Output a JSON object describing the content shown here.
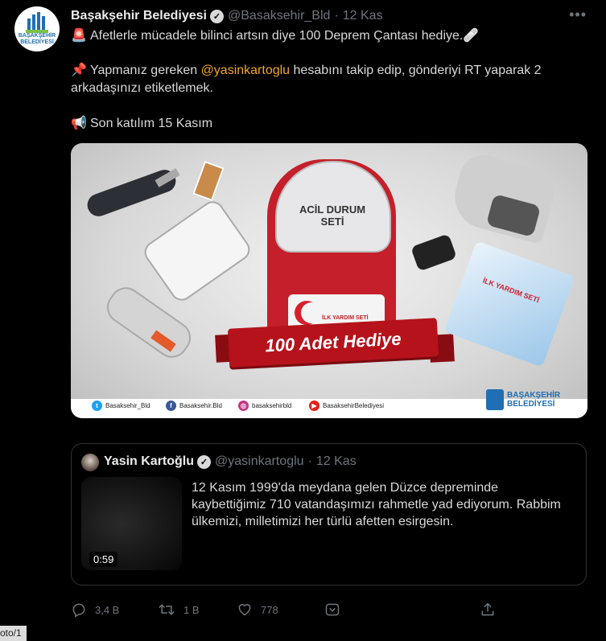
{
  "tweet": {
    "author_name": "Başakşehir Belediyesi",
    "author_handle": "@Basaksehir_Bld",
    "separator": "·",
    "time": "12 Kas",
    "more_icon": "more-horizontal-icon",
    "avatar_text": "BAŞAKŞEHİR BELEDİYESİ",
    "line1": "Afetlerle mücadele bilinci artsın diye 100 Deprem Çantası hediye.",
    "line2_prefix": "Yapmanız gereken ",
    "line2_mention": "@yasinkartoglu",
    "line2_suffix": " hesabını takip edip, gönderiyi RT yaparak 2 arkadaşınızı etiketlemek.",
    "line3": "Son katılım 15 Kasım",
    "emoji1": "🚨",
    "emoji1_end": "🩹",
    "emoji2": "📌",
    "emoji3": "📢"
  },
  "media": {
    "bag_label": "ACİL DURUM SETİ",
    "card_text": "İLK YARDIM SETİ",
    "ribbon_text": "100 Adet Hediye",
    "blanket_text": "İLK YARDIM SETİ",
    "social": [
      {
        "icon": "twitter-icon",
        "label": "Basaksehir_Bld",
        "color": "#1da1f2",
        "glyph": "t"
      },
      {
        "icon": "facebook-icon",
        "label": "Basaksehir.Bld",
        "color": "#3b5998",
        "glyph": "f"
      },
      {
        "icon": "instagram-icon",
        "label": "basaksehirbld",
        "color": "#c13584",
        "glyph": "◎"
      },
      {
        "icon": "youtube-icon",
        "label": "BasaksehirBelediyesi",
        "color": "#e62117",
        "glyph": "▶"
      }
    ],
    "brand_line1": "BAŞAKŞEHİR",
    "brand_line2": "BELEDİYESİ"
  },
  "quote": {
    "author_name": "Yasin Kartoğlu",
    "author_handle": "@yasinkartoglu",
    "separator": "·",
    "time": "12 Kas",
    "text": "12 Kasım 1999'da meydana gelen Düzce depreminde kaybettiğimiz 710 vatandaşımızı rahmetle yad ediyorum. Rabbim ülkemizi, milletimizi her türlü afetten esirgesin.",
    "video_duration": "0:59"
  },
  "actions": {
    "reply_count": "3,4 B",
    "retweet_count": "1 B",
    "like_count": "778"
  },
  "status_bar": {
    "url_fragment": "oto/1"
  }
}
